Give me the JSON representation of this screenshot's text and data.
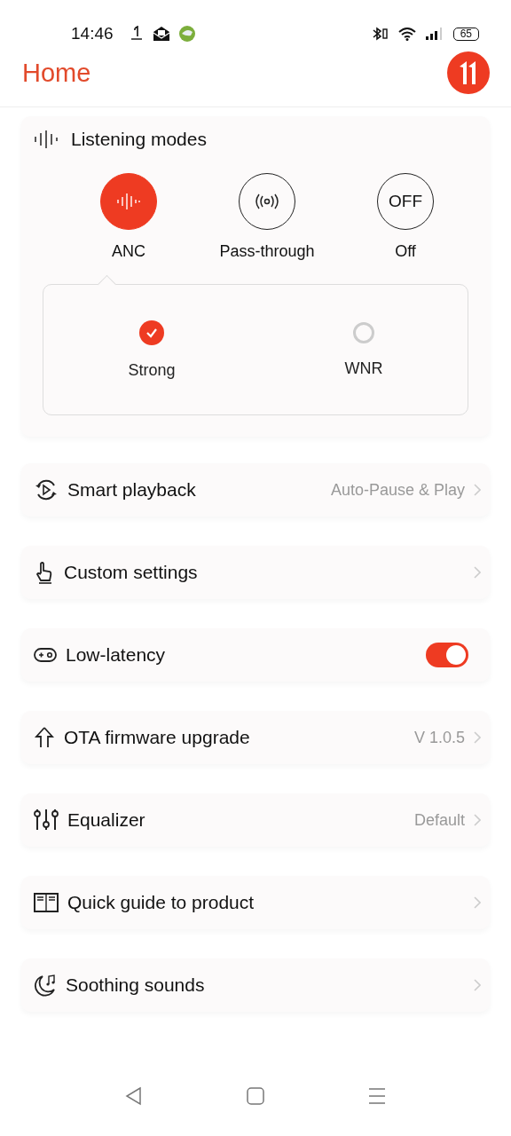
{
  "status_bar": {
    "time": "14:46",
    "battery": "65"
  },
  "header": {
    "title": "Home"
  },
  "listening_modes": {
    "title": "Listening modes",
    "modes": [
      {
        "label": "ANC",
        "selected": true,
        "kind": "wave"
      },
      {
        "label": "Pass-through",
        "selected": false,
        "kind": "signal"
      },
      {
        "label": "Off",
        "selected": false,
        "kind": "text",
        "glyph": "OFF"
      }
    ],
    "options": [
      {
        "label": "Strong",
        "selected": true
      },
      {
        "label": "WNR",
        "selected": false
      }
    ]
  },
  "settings": [
    {
      "label": "Smart playback",
      "kind": "link",
      "value": "Auto-Pause & Play"
    },
    {
      "label": "Custom settings",
      "kind": "link"
    },
    {
      "label": "Low-latency",
      "kind": "toggle",
      "on": true
    },
    {
      "label": "OTA firmware upgrade",
      "kind": "link",
      "value": "V 1.0.5"
    },
    {
      "label": "Equalizer",
      "kind": "link",
      "value": "Default"
    },
    {
      "label": "Quick guide to product",
      "kind": "link"
    },
    {
      "label": "Soothing sounds",
      "kind": "link"
    }
  ]
}
